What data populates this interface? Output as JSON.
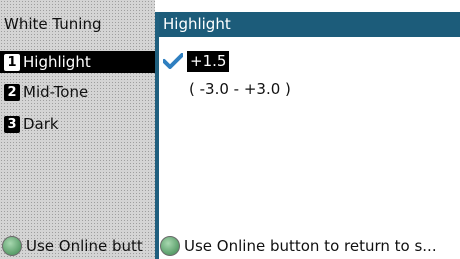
{
  "menu": {
    "title": "White Tuning",
    "items": [
      {
        "num": "1",
        "label": "Highlight",
        "selected": true
      },
      {
        "num": "2",
        "label": "Mid-Tone",
        "selected": false
      },
      {
        "num": "3",
        "label": "Dark",
        "selected": false
      }
    ]
  },
  "detail": {
    "title": "Highlight",
    "value": "+1.5",
    "range": "( -3.0 - +3.0 )"
  },
  "help": {
    "left_text": "Use Online butt",
    "right_text": "Use Online button to return to s..."
  },
  "colors": {
    "header": "#1c5c7a",
    "selected_bg": "#000000",
    "check": "#2f7fc0"
  },
  "icons": {
    "check": "check-icon",
    "online": "online-button-icon"
  }
}
